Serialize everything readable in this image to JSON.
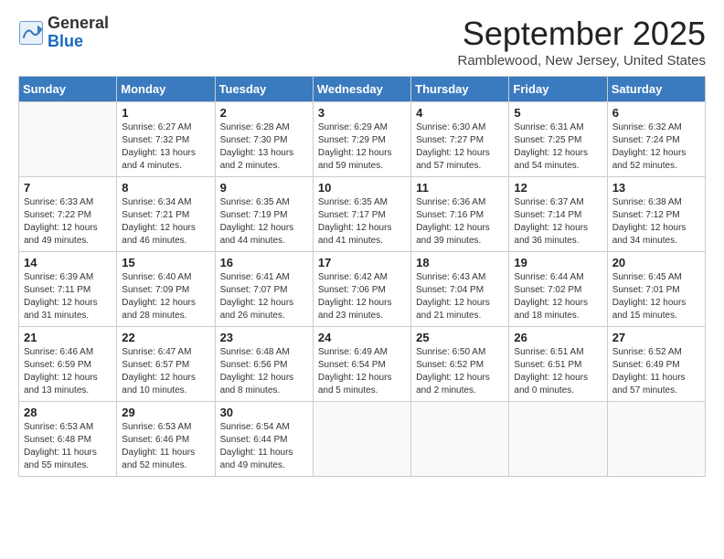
{
  "logo": {
    "general": "General",
    "blue": "Blue"
  },
  "title": "September 2025",
  "subtitle": "Ramblewood, New Jersey, United States",
  "weekdays": [
    "Sunday",
    "Monday",
    "Tuesday",
    "Wednesday",
    "Thursday",
    "Friday",
    "Saturday"
  ],
  "weeks": [
    [
      {
        "day": "",
        "info": ""
      },
      {
        "day": "1",
        "info": "Sunrise: 6:27 AM\nSunset: 7:32 PM\nDaylight: 13 hours\nand 4 minutes."
      },
      {
        "day": "2",
        "info": "Sunrise: 6:28 AM\nSunset: 7:30 PM\nDaylight: 13 hours\nand 2 minutes."
      },
      {
        "day": "3",
        "info": "Sunrise: 6:29 AM\nSunset: 7:29 PM\nDaylight: 12 hours\nand 59 minutes."
      },
      {
        "day": "4",
        "info": "Sunrise: 6:30 AM\nSunset: 7:27 PM\nDaylight: 12 hours\nand 57 minutes."
      },
      {
        "day": "5",
        "info": "Sunrise: 6:31 AM\nSunset: 7:25 PM\nDaylight: 12 hours\nand 54 minutes."
      },
      {
        "day": "6",
        "info": "Sunrise: 6:32 AM\nSunset: 7:24 PM\nDaylight: 12 hours\nand 52 minutes."
      }
    ],
    [
      {
        "day": "7",
        "info": "Sunrise: 6:33 AM\nSunset: 7:22 PM\nDaylight: 12 hours\nand 49 minutes."
      },
      {
        "day": "8",
        "info": "Sunrise: 6:34 AM\nSunset: 7:21 PM\nDaylight: 12 hours\nand 46 minutes."
      },
      {
        "day": "9",
        "info": "Sunrise: 6:35 AM\nSunset: 7:19 PM\nDaylight: 12 hours\nand 44 minutes."
      },
      {
        "day": "10",
        "info": "Sunrise: 6:35 AM\nSunset: 7:17 PM\nDaylight: 12 hours\nand 41 minutes."
      },
      {
        "day": "11",
        "info": "Sunrise: 6:36 AM\nSunset: 7:16 PM\nDaylight: 12 hours\nand 39 minutes."
      },
      {
        "day": "12",
        "info": "Sunrise: 6:37 AM\nSunset: 7:14 PM\nDaylight: 12 hours\nand 36 minutes."
      },
      {
        "day": "13",
        "info": "Sunrise: 6:38 AM\nSunset: 7:12 PM\nDaylight: 12 hours\nand 34 minutes."
      }
    ],
    [
      {
        "day": "14",
        "info": "Sunrise: 6:39 AM\nSunset: 7:11 PM\nDaylight: 12 hours\nand 31 minutes."
      },
      {
        "day": "15",
        "info": "Sunrise: 6:40 AM\nSunset: 7:09 PM\nDaylight: 12 hours\nand 28 minutes."
      },
      {
        "day": "16",
        "info": "Sunrise: 6:41 AM\nSunset: 7:07 PM\nDaylight: 12 hours\nand 26 minutes."
      },
      {
        "day": "17",
        "info": "Sunrise: 6:42 AM\nSunset: 7:06 PM\nDaylight: 12 hours\nand 23 minutes."
      },
      {
        "day": "18",
        "info": "Sunrise: 6:43 AM\nSunset: 7:04 PM\nDaylight: 12 hours\nand 21 minutes."
      },
      {
        "day": "19",
        "info": "Sunrise: 6:44 AM\nSunset: 7:02 PM\nDaylight: 12 hours\nand 18 minutes."
      },
      {
        "day": "20",
        "info": "Sunrise: 6:45 AM\nSunset: 7:01 PM\nDaylight: 12 hours\nand 15 minutes."
      }
    ],
    [
      {
        "day": "21",
        "info": "Sunrise: 6:46 AM\nSunset: 6:59 PM\nDaylight: 12 hours\nand 13 minutes."
      },
      {
        "day": "22",
        "info": "Sunrise: 6:47 AM\nSunset: 6:57 PM\nDaylight: 12 hours\nand 10 minutes."
      },
      {
        "day": "23",
        "info": "Sunrise: 6:48 AM\nSunset: 6:56 PM\nDaylight: 12 hours\nand 8 minutes."
      },
      {
        "day": "24",
        "info": "Sunrise: 6:49 AM\nSunset: 6:54 PM\nDaylight: 12 hours\nand 5 minutes."
      },
      {
        "day": "25",
        "info": "Sunrise: 6:50 AM\nSunset: 6:52 PM\nDaylight: 12 hours\nand 2 minutes."
      },
      {
        "day": "26",
        "info": "Sunrise: 6:51 AM\nSunset: 6:51 PM\nDaylight: 12 hours\nand 0 minutes."
      },
      {
        "day": "27",
        "info": "Sunrise: 6:52 AM\nSunset: 6:49 PM\nDaylight: 11 hours\nand 57 minutes."
      }
    ],
    [
      {
        "day": "28",
        "info": "Sunrise: 6:53 AM\nSunset: 6:48 PM\nDaylight: 11 hours\nand 55 minutes."
      },
      {
        "day": "29",
        "info": "Sunrise: 6:53 AM\nSunset: 6:46 PM\nDaylight: 11 hours\nand 52 minutes."
      },
      {
        "day": "30",
        "info": "Sunrise: 6:54 AM\nSunset: 6:44 PM\nDaylight: 11 hours\nand 49 minutes."
      },
      {
        "day": "",
        "info": ""
      },
      {
        "day": "",
        "info": ""
      },
      {
        "day": "",
        "info": ""
      },
      {
        "day": "",
        "info": ""
      }
    ]
  ]
}
